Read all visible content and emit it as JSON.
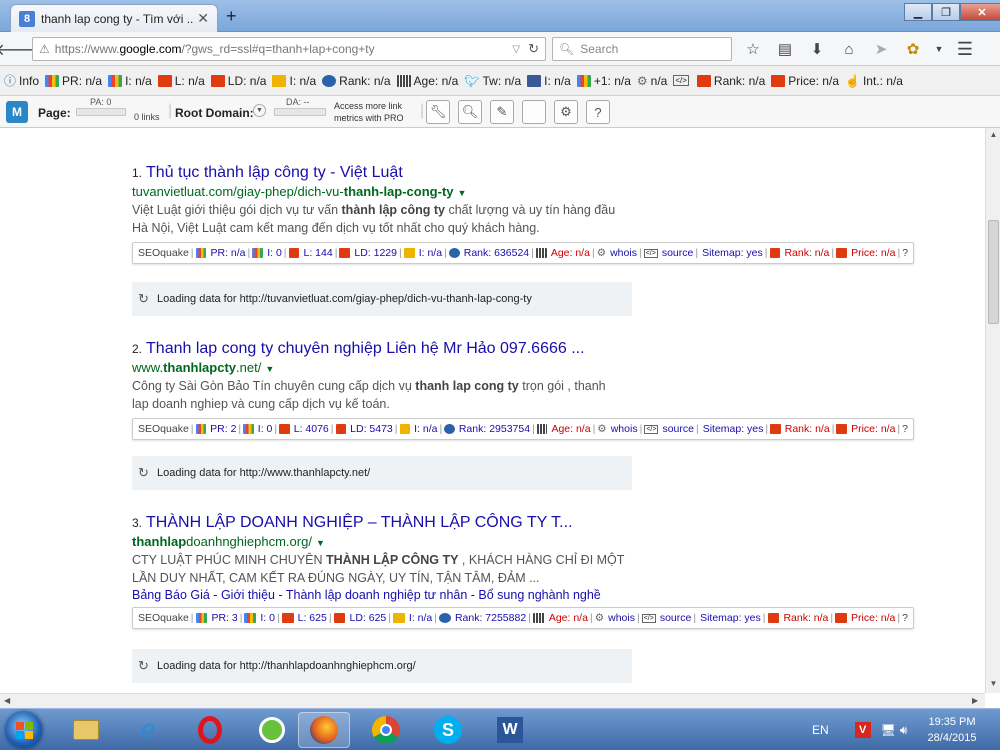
{
  "browser": {
    "tab_title": "thanh lap cong ty - Tìm với ...",
    "tab_favicon": "8",
    "url_prefix": "https://www.",
    "url_domain": "google.com",
    "url_rest": "/?gws_rd=ssl#q=thanh+lap+cong+ty",
    "search_placeholder": "Search"
  },
  "seobar": {
    "items": [
      {
        "icon": "info",
        "label": "Info"
      },
      {
        "icon": "g",
        "label": "PR: n/a"
      },
      {
        "icon": "g",
        "label": "I: n/a"
      },
      {
        "icon": "r",
        "label": "L: n/a"
      },
      {
        "icon": "r",
        "label": "LD: n/a"
      },
      {
        "icon": "y",
        "label": "I: n/a"
      },
      {
        "icon": "b",
        "label": "Rank: n/a"
      },
      {
        "icon": "bar",
        "label": "Age: n/a"
      },
      {
        "icon": "tw",
        "label": "Tw: n/a"
      },
      {
        "icon": "fb",
        "label": "I: n/a"
      },
      {
        "icon": "g",
        "label": "+1: n/a"
      },
      {
        "icon": "gear",
        "label": "n/a"
      },
      {
        "icon": "src",
        "label": ""
      },
      {
        "icon": "r",
        "label": "Rank: n/a"
      },
      {
        "icon": "r",
        "label": "Price: n/a"
      },
      {
        "icon": "hand",
        "label": "Int.: n/a"
      }
    ]
  },
  "mozbar": {
    "logo": "M",
    "page_label": "Page:",
    "pa": "PA: 0",
    "links": "0 links",
    "root_label": "Root Domain:",
    "da": "DA: --",
    "access_line1": "Access more link",
    "access_line2": "metrics with PRO"
  },
  "results": [
    {
      "num": "1.",
      "title": "Thủ tục thành lập công ty - Việt Luật",
      "url_pre": "tuvanvietluat.com/giay-phep/dich-vu-",
      "url_bold": "thanh-lap-cong-ty",
      "url_post": "",
      "snippet_1a": "Việt Luật giới thiệu gói dịch vụ tư vấn ",
      "snippet_1b": "thành lập công ty",
      "snippet_1c": " chất lượng và uy tín hàng đầu",
      "snippet_2": "Hà Nội, Việt Luật cam kết mang đến dịch vụ tốt nhất cho quý khách hàng.",
      "links": "",
      "seo": {
        "brand": "SEOquake",
        "pr": "PR: n/a",
        "i": "I: 0",
        "l": "L: 144",
        "ld": "LD: 1229",
        "i2": "I: n/a",
        "rank": "Rank: 636524",
        "age": "Age: n/a",
        "whois": "whois",
        "source": "source",
        "sitemap": "Sitemap: yes",
        "rank2": "Rank: n/a",
        "price": "Price: n/a",
        "q": "?"
      },
      "loading": "Loading data for http://tuvanvietluat.com/giay-phep/dich-vu-thanh-lap-cong-ty"
    },
    {
      "num": "2.",
      "title": "Thanh lap cong ty chuyên nghiệp Liên hệ Mr Hảo 097.6666 ...",
      "url_pre": "www.",
      "url_bold": "thanhlapcty",
      "url_post": ".net/",
      "snippet_1a": "Công ty Sài Gòn Bảo Tín chuyên cung cấp dịch vụ ",
      "snippet_1b": "thanh lap cong ty",
      "snippet_1c": " trọn gói , thanh",
      "snippet_2": "lap doanh nghiep và cung cấp dịch vụ kế toán.",
      "links": "",
      "seo": {
        "brand": "SEOquake",
        "pr": "PR: 2",
        "i": "I: 0",
        "l": "L: 4076",
        "ld": "LD: 5473",
        "i2": "I: n/a",
        "rank": "Rank: 2953754",
        "age": "Age: n/a",
        "whois": "whois",
        "source": "source",
        "sitemap": "Sitemap: yes",
        "rank2": "Rank: n/a",
        "price": "Price: n/a",
        "q": "?"
      },
      "loading": "Loading data for http://www.thanhlapcty.net/"
    },
    {
      "num": "3.",
      "title": "THÀNH LẬP DOANH NGHIỆP – THÀNH LẬP CÔNG TY T...",
      "url_pre": "",
      "url_bold": "thanhlap",
      "url_post": "doanhnghiephcm.org/",
      "snippet_1a": "CTY LUẬT PHÚC MINH CHUYÊN ",
      "snippet_1b": "THÀNH LẬP CÔNG TY",
      "snippet_1c": " , KHÁCH HÀNG CHỈ ĐI MỘT",
      "snippet_2": "LẦN DUY NHẤT, CAM KẾT RA ĐÚNG NGÀY, UY TÍN, TẬN TÂM, ĐẢM ...",
      "links": "Bảng Báo Giá - Giới thiệu - Thành lập doanh nghiệp tư nhân - Bổ sung nghành nghề",
      "seo": {
        "brand": "SEOquake",
        "pr": "PR: 3",
        "i": "I: 0",
        "l": "L: 625",
        "ld": "LD: 625",
        "i2": "I: n/a",
        "rank": "Rank: 7255882",
        "age": "Age: n/a",
        "whois": "whois",
        "source": "source",
        "sitemap": "Sitemap: yes",
        "rank2": "Rank: n/a",
        "price": "Price: n/a",
        "q": "?"
      },
      "loading": "Loading data for http://thanhlapdoanhnghiephcm.org/"
    }
  ],
  "taskbar": {
    "lang": "EN",
    "time": "19:35 PM",
    "date": "28/4/2015"
  }
}
